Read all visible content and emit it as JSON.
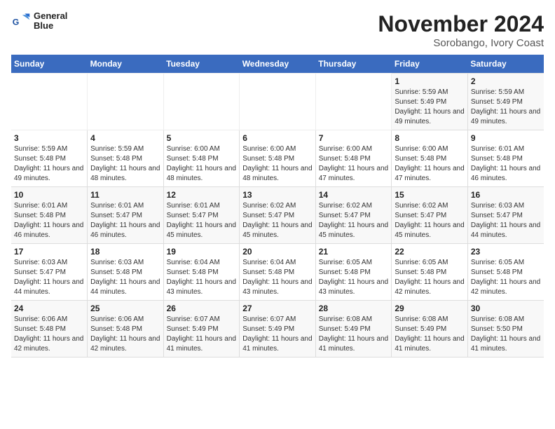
{
  "logo": {
    "line1": "General",
    "line2": "Blue"
  },
  "header": {
    "title": "November 2024",
    "subtitle": "Sorobango, Ivory Coast"
  },
  "weekdays": [
    "Sunday",
    "Monday",
    "Tuesday",
    "Wednesday",
    "Thursday",
    "Friday",
    "Saturday"
  ],
  "weeks": [
    [
      {
        "day": "",
        "info": ""
      },
      {
        "day": "",
        "info": ""
      },
      {
        "day": "",
        "info": ""
      },
      {
        "day": "",
        "info": ""
      },
      {
        "day": "",
        "info": ""
      },
      {
        "day": "1",
        "info": "Sunrise: 5:59 AM\nSunset: 5:49 PM\nDaylight: 11 hours and 49 minutes."
      },
      {
        "day": "2",
        "info": "Sunrise: 5:59 AM\nSunset: 5:49 PM\nDaylight: 11 hours and 49 minutes."
      }
    ],
    [
      {
        "day": "3",
        "info": "Sunrise: 5:59 AM\nSunset: 5:48 PM\nDaylight: 11 hours and 49 minutes."
      },
      {
        "day": "4",
        "info": "Sunrise: 5:59 AM\nSunset: 5:48 PM\nDaylight: 11 hours and 48 minutes."
      },
      {
        "day": "5",
        "info": "Sunrise: 6:00 AM\nSunset: 5:48 PM\nDaylight: 11 hours and 48 minutes."
      },
      {
        "day": "6",
        "info": "Sunrise: 6:00 AM\nSunset: 5:48 PM\nDaylight: 11 hours and 48 minutes."
      },
      {
        "day": "7",
        "info": "Sunrise: 6:00 AM\nSunset: 5:48 PM\nDaylight: 11 hours and 47 minutes."
      },
      {
        "day": "8",
        "info": "Sunrise: 6:00 AM\nSunset: 5:48 PM\nDaylight: 11 hours and 47 minutes."
      },
      {
        "day": "9",
        "info": "Sunrise: 6:01 AM\nSunset: 5:48 PM\nDaylight: 11 hours and 46 minutes."
      }
    ],
    [
      {
        "day": "10",
        "info": "Sunrise: 6:01 AM\nSunset: 5:48 PM\nDaylight: 11 hours and 46 minutes."
      },
      {
        "day": "11",
        "info": "Sunrise: 6:01 AM\nSunset: 5:47 PM\nDaylight: 11 hours and 46 minutes."
      },
      {
        "day": "12",
        "info": "Sunrise: 6:01 AM\nSunset: 5:47 PM\nDaylight: 11 hours and 45 minutes."
      },
      {
        "day": "13",
        "info": "Sunrise: 6:02 AM\nSunset: 5:47 PM\nDaylight: 11 hours and 45 minutes."
      },
      {
        "day": "14",
        "info": "Sunrise: 6:02 AM\nSunset: 5:47 PM\nDaylight: 11 hours and 45 minutes."
      },
      {
        "day": "15",
        "info": "Sunrise: 6:02 AM\nSunset: 5:47 PM\nDaylight: 11 hours and 45 minutes."
      },
      {
        "day": "16",
        "info": "Sunrise: 6:03 AM\nSunset: 5:47 PM\nDaylight: 11 hours and 44 minutes."
      }
    ],
    [
      {
        "day": "17",
        "info": "Sunrise: 6:03 AM\nSunset: 5:47 PM\nDaylight: 11 hours and 44 minutes."
      },
      {
        "day": "18",
        "info": "Sunrise: 6:03 AM\nSunset: 5:48 PM\nDaylight: 11 hours and 44 minutes."
      },
      {
        "day": "19",
        "info": "Sunrise: 6:04 AM\nSunset: 5:48 PM\nDaylight: 11 hours and 43 minutes."
      },
      {
        "day": "20",
        "info": "Sunrise: 6:04 AM\nSunset: 5:48 PM\nDaylight: 11 hours and 43 minutes."
      },
      {
        "day": "21",
        "info": "Sunrise: 6:05 AM\nSunset: 5:48 PM\nDaylight: 11 hours and 43 minutes."
      },
      {
        "day": "22",
        "info": "Sunrise: 6:05 AM\nSunset: 5:48 PM\nDaylight: 11 hours and 42 minutes."
      },
      {
        "day": "23",
        "info": "Sunrise: 6:05 AM\nSunset: 5:48 PM\nDaylight: 11 hours and 42 minutes."
      }
    ],
    [
      {
        "day": "24",
        "info": "Sunrise: 6:06 AM\nSunset: 5:48 PM\nDaylight: 11 hours and 42 minutes."
      },
      {
        "day": "25",
        "info": "Sunrise: 6:06 AM\nSunset: 5:48 PM\nDaylight: 11 hours and 42 minutes."
      },
      {
        "day": "26",
        "info": "Sunrise: 6:07 AM\nSunset: 5:49 PM\nDaylight: 11 hours and 41 minutes."
      },
      {
        "day": "27",
        "info": "Sunrise: 6:07 AM\nSunset: 5:49 PM\nDaylight: 11 hours and 41 minutes."
      },
      {
        "day": "28",
        "info": "Sunrise: 6:08 AM\nSunset: 5:49 PM\nDaylight: 11 hours and 41 minutes."
      },
      {
        "day": "29",
        "info": "Sunrise: 6:08 AM\nSunset: 5:49 PM\nDaylight: 11 hours and 41 minutes."
      },
      {
        "day": "30",
        "info": "Sunrise: 6:08 AM\nSunset: 5:50 PM\nDaylight: 11 hours and 41 minutes."
      }
    ]
  ]
}
